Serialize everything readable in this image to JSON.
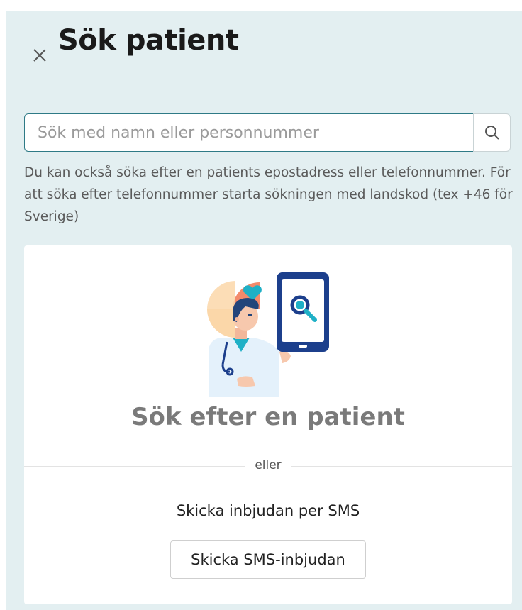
{
  "header": {
    "title": "Sök patient",
    "close_icon": "close-icon"
  },
  "search": {
    "placeholder": "Sök med namn eller personnummer",
    "value": "",
    "button_icon": "search-icon"
  },
  "help_text": "Du kan också söka efter en patients epostadress eller telefonnummer. För att söka efter telefonnummer starta sökningen med landskod (tex +46 för Sverige)",
  "card": {
    "illustration": "doctor-with-phone-illustration",
    "heading": "Sök efter en patient",
    "divider": "eller",
    "sms_label": "Skicka inbjudan per SMS",
    "sms_button": "Skicka SMS-inbjudan"
  },
  "colors": {
    "panel_bg": "#e3eff1",
    "accent": "#2e7a86",
    "phone_navy": "#1c3f8c",
    "illus_teal": "#1fb0c6",
    "illus_coral": "#f38a6b",
    "illus_peach": "#fbd7a9"
  }
}
